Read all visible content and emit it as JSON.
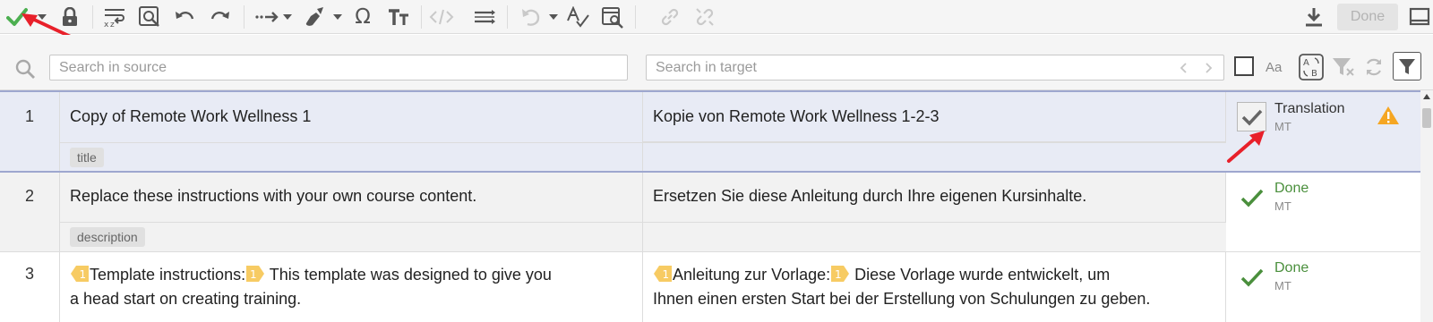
{
  "toolbar": {
    "buttons": [
      {
        "icon": "checkmark-icon",
        "color": "#4caf50"
      },
      {
        "icon": "lock-icon"
      },
      {
        "icon": "word-wrap-icon"
      },
      {
        "icon": "find-replace-icon"
      },
      {
        "icon": "undo-icon"
      },
      {
        "icon": "redo-icon"
      },
      {
        "icon": "insert-tags-icon"
      },
      {
        "icon": "clear-format-icon"
      },
      {
        "icon": "omega-icon"
      },
      {
        "icon": "text-size-icon"
      },
      {
        "icon": "code-tags-icon",
        "disabled": true
      },
      {
        "icon": "line-spacing-icon"
      },
      {
        "icon": "revert-icon",
        "disabled": true
      },
      {
        "icon": "spell-check-icon"
      },
      {
        "icon": "qa-check-icon"
      },
      {
        "icon": "link-icon",
        "disabled": true
      },
      {
        "icon": "unlink-icon",
        "disabled": true
      },
      {
        "icon": "download-icon"
      },
      {
        "icon": "layout-icon"
      }
    ],
    "omega_glyph": "Ω",
    "done_label": "Done"
  },
  "search": {
    "source_placeholder": "Search in source",
    "target_placeholder": "Search in target",
    "case_label": "Aa"
  },
  "segments": [
    {
      "num": "1",
      "source": "Copy of Remote Work Wellness 1",
      "target": "Kopie von Remote Work Wellness 1-2-3",
      "context": "title",
      "status": "Translation",
      "origin": "MT",
      "warning": true
    },
    {
      "num": "2",
      "source": "Replace these instructions with your own course content.",
      "target": "Ersetzen Sie diese Anleitung durch Ihre eigenen Kursinhalte.",
      "context": "description",
      "status": "Done",
      "origin": "MT"
    },
    {
      "num": "3",
      "source_tag_open": "1",
      "source_part1": "Template instructions:",
      "source_tag_close": "1",
      "source_part2": "This template was designed to give you",
      "source_line2": "a head start on creating training.",
      "target_tag_open": "1",
      "target_part1": "Anleitung zur Vorlage:",
      "target_tag_close": "1",
      "target_part2": "Diese Vorlage wurde entwickelt, um",
      "target_line2": "Ihnen einen ersten Start bei der Erstellung von Schulungen zu geben.",
      "status": "Done",
      "origin": "MT"
    }
  ],
  "colors": {
    "selected_row": "#e8ebf5",
    "row_alt": "#f2f2f2",
    "done_green": "#4a8f3c",
    "warning": "#f5a623",
    "annotation_arrow": "#e8202a"
  }
}
